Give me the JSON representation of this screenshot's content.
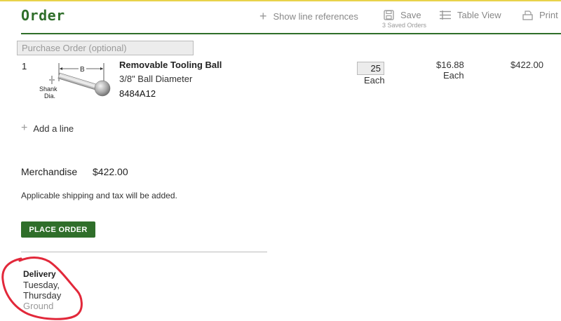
{
  "header": {
    "title": "Order",
    "tools": {
      "show_line_refs": "Show line references",
      "save": "Save",
      "saved_count": "3 Saved Orders",
      "table_view": "Table View",
      "print": "Print"
    }
  },
  "purchase_order": {
    "placeholder": "Purchase Order (optional)"
  },
  "line_item": {
    "number": "1",
    "image_labels": {
      "b": "B",
      "shank": "Shank",
      "dia": "Dia."
    },
    "name": "Removable Tooling Ball",
    "description": "3/8\" Ball Diameter",
    "part_number": "8484A12",
    "quantity": "25",
    "quantity_unit": "Each",
    "unit_price": "$16.88",
    "price_unit": "Each",
    "line_total": "$422.00"
  },
  "add_line": {
    "label": "Add a line"
  },
  "summary": {
    "merchandise_label": "Merchandise",
    "merchandise_value": "$422.00",
    "shipping_note": "Applicable shipping and tax will be added."
  },
  "actions": {
    "place_order": "PLACE ORDER"
  },
  "delivery": {
    "title": "Delivery",
    "days": "Tuesday, Thursday",
    "method": "Ground"
  },
  "colors": {
    "brand_green": "#2f6e2a",
    "annotation_red": "#e2283a",
    "top_accent": "#e8d24a"
  },
  "icons": [
    "plus-icon",
    "save-icon",
    "table-view-icon",
    "print-icon"
  ]
}
